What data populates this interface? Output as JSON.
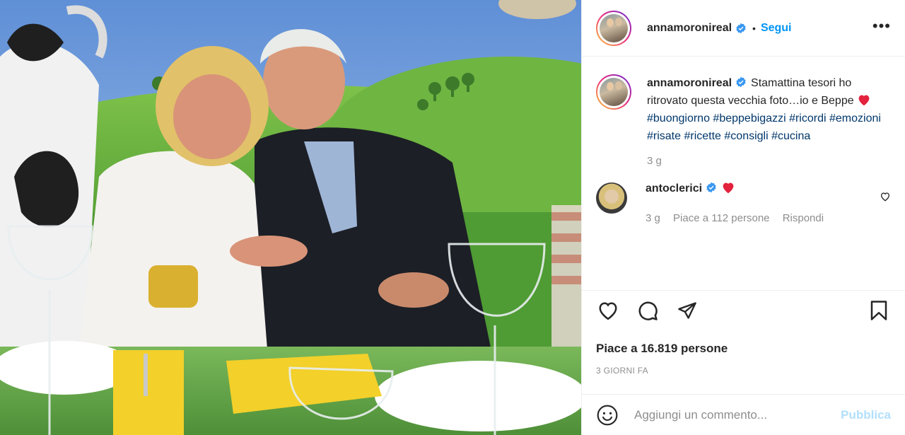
{
  "post": {
    "image_alt": "",
    "author": {
      "username": "annamoronireal",
      "verified": true,
      "follow_label": "Segui",
      "separator": "•",
      "more_label": "•••"
    },
    "caption": {
      "username": "annamoronireal",
      "text": "Stamattina tesori ho ritrovato questa vecchia foto…io e Beppe",
      "hashtags": [
        "#buongiorno",
        "#beppebigazzi",
        "#ricordi",
        "#emozioni",
        "#risate",
        "#ricette",
        "#consigli",
        "#cucina"
      ],
      "age": "3 g"
    },
    "comments": [
      {
        "username": "antoclerici",
        "verified": true,
        "text_icon": "red-heart-emoji",
        "age": "3 g",
        "likes_label": "Piace a 112 persone",
        "reply_label": "Rispondi"
      }
    ],
    "actions": {
      "icons": [
        "heart-icon",
        "comment-icon",
        "share-icon",
        "bookmark-icon"
      ]
    },
    "likes_label": "Piace a 16.819 persone",
    "timestamp": "3 GIORNI FA",
    "add_comment": {
      "placeholder": "Aggiungi un commento...",
      "publish_label": "Pubblica"
    },
    "colors": {
      "link_blue": "#0095f6",
      "hashtag": "#00376b",
      "muted": "#8e8e8e",
      "publish_disabled": "#b2dffc",
      "verified": "#3897f0",
      "heart": "#ed4956"
    }
  }
}
